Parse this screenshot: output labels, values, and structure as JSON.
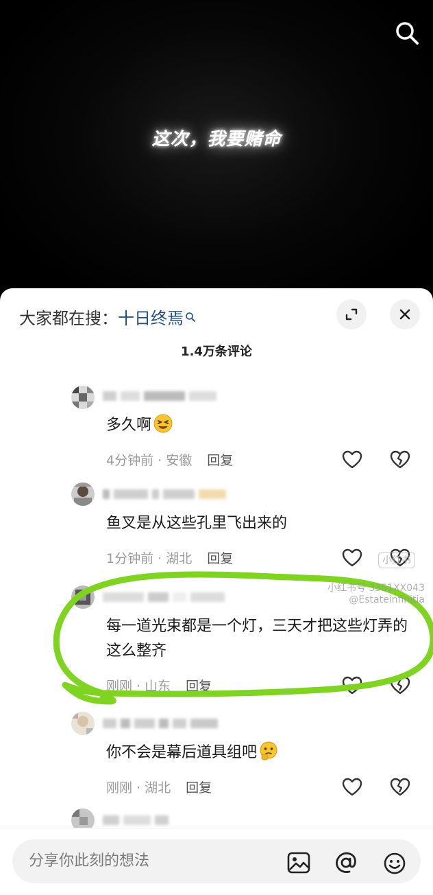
{
  "video": {
    "caption": "这次，我要赌命"
  },
  "comments_panel": {
    "hot_search_prefix": "大家都在搜：",
    "hot_search_keyword": "十日终焉",
    "comment_count": "1.4万条评论",
    "comments": [
      {
        "text": "多久啊",
        "emoji": "laughing-face-emoji",
        "time": "4分钟前",
        "location": "安徽",
        "reply_label": "回复"
      },
      {
        "text": "鱼叉是从这些孔里飞出来的",
        "time": "1分钟前",
        "location": "湖北",
        "reply_label": "回复"
      },
      {
        "text": "每一道光束都是一个灯，三天才把这些灯弄的这么整齐",
        "time": "刚刚",
        "location": "山东",
        "reply_label": "回复"
      },
      {
        "text": "你不会是幕后道具组吧",
        "emoji": "thinking-face-emoji",
        "time": "刚刚",
        "location": "湖北",
        "reply_label": "回复"
      }
    ],
    "input_placeholder": "分享你此刻的想法"
  },
  "watermark": {
    "badge": "小红书",
    "line1": "小红书号 3351XX043",
    "line2": "@Estateinfinitia"
  },
  "colors": {
    "highlight_ring": "#7fd321",
    "keyword_link": "#1e4f8a"
  }
}
